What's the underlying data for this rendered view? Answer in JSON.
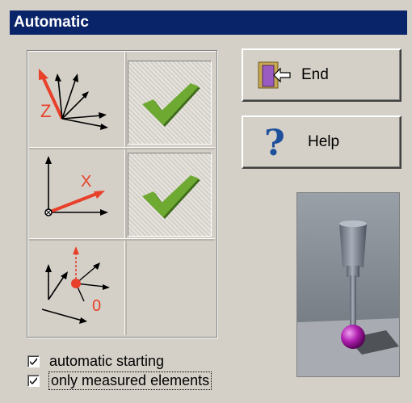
{
  "window": {
    "title": "Automatic"
  },
  "buttons": {
    "end_label": "End",
    "help_label": "Help"
  },
  "axis_icons": {
    "z_label": "Z",
    "x_label": "X",
    "origin_label": "0"
  },
  "checkboxes": [
    {
      "label": "automatic starting",
      "checked": true
    },
    {
      "label": "only measured elements",
      "checked": true
    }
  ],
  "colors": {
    "titlebar": "#0a246a",
    "axis_red": "#e8402a",
    "check_green": "#5c9a28",
    "probe_purple": "#a020a0"
  }
}
